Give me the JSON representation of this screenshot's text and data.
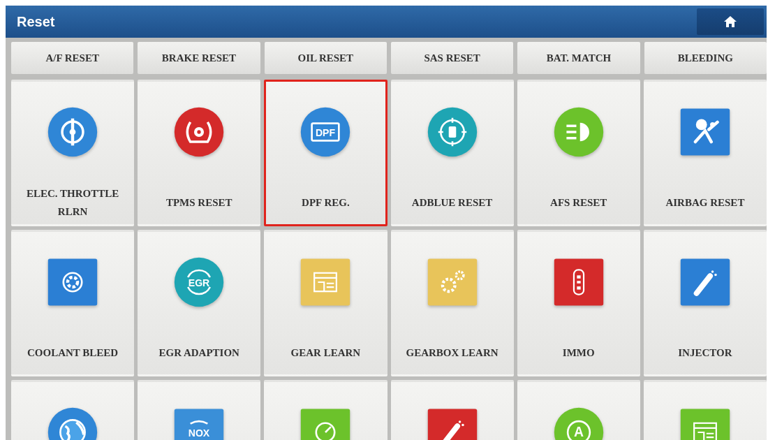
{
  "window": {
    "title": "Reset"
  },
  "tabs": [
    {
      "label": "A/F RESET"
    },
    {
      "label": "BRAKE RESET"
    },
    {
      "label": "OIL RESET"
    },
    {
      "label": "SAS RESET"
    },
    {
      "label": "BAT. MATCH"
    },
    {
      "label": "BLEEDING"
    }
  ],
  "tiles": [
    {
      "label": "ELEC. THROTTLE RLRN",
      "selected": false,
      "icon": {
        "kind": "throttle",
        "color": "#2f86d6"
      }
    },
    {
      "label": "TPMS RESET",
      "selected": false,
      "icon": {
        "kind": "tire",
        "color": "#d42a2a"
      }
    },
    {
      "label": "DPF REG.",
      "selected": true,
      "icon": {
        "kind": "panel",
        "color": "#2f86d6",
        "text": "DPF"
      }
    },
    {
      "label": "ADBLUE RESET",
      "selected": false,
      "icon": {
        "kind": "target",
        "color": "#1ea5b3"
      }
    },
    {
      "label": "AFS RESET",
      "selected": false,
      "icon": {
        "kind": "headlight",
        "color": "#6cc22b"
      }
    },
    {
      "label": "AIRBAG RESET",
      "selected": false,
      "icon": {
        "kind": "airbag",
        "color": "#2b7fd4"
      }
    },
    {
      "label": "COOLANT BLEED",
      "selected": false,
      "icon": {
        "kind": "fan",
        "color": "#2b7fd4"
      }
    },
    {
      "label": "EGR ADAPTION",
      "selected": false,
      "icon": {
        "kind": "cycle",
        "color": "#1ea5b3",
        "text": "EGR"
      }
    },
    {
      "label": "GEAR LEARN",
      "selected": false,
      "icon": {
        "kind": "window",
        "color": "#e8c45a"
      }
    },
    {
      "label": "GEARBOX LEARN",
      "selected": false,
      "icon": {
        "kind": "gears",
        "color": "#e8c45a"
      }
    },
    {
      "label": "IMMO",
      "selected": false,
      "icon": {
        "kind": "fob",
        "color": "#d42a2a"
      }
    },
    {
      "label": "INJECTOR",
      "selected": false,
      "icon": {
        "kind": "injector",
        "color": "#2b7fd4"
      }
    },
    {
      "selected": false,
      "icon": {
        "kind": "globe",
        "color": "#2f86d6"
      }
    },
    {
      "selected": false,
      "icon": {
        "kind": "arc",
        "color": "#3a8fd8",
        "text": "NOX"
      }
    },
    {
      "selected": false,
      "icon": {
        "kind": "gauge",
        "color": "#6cc22b"
      }
    },
    {
      "selected": false,
      "icon": {
        "kind": "injector",
        "color": "#d42a2a"
      }
    },
    {
      "selected": false,
      "icon": {
        "kind": "ring",
        "color": "#6cc22b",
        "text": "A"
      }
    },
    {
      "selected": false,
      "icon": {
        "kind": "window",
        "color": "#6cc22b"
      }
    }
  ]
}
